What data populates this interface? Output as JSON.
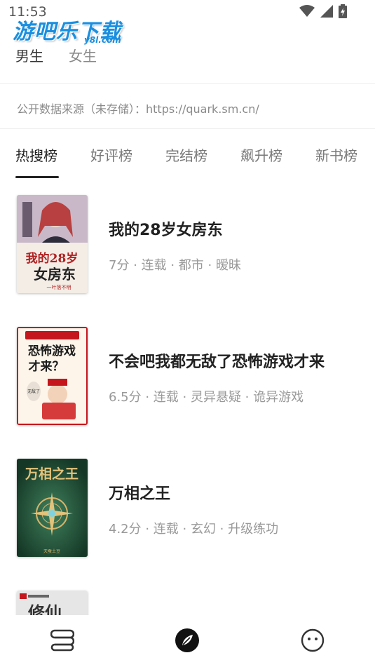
{
  "status_bar": {
    "time": "11:53"
  },
  "watermark": {
    "text": "游吧乐下载",
    "sub": "y8l.com"
  },
  "gender_tabs": [
    {
      "label": "男生",
      "active": true
    },
    {
      "label": "女生",
      "active": false
    }
  ],
  "source_note": "公开数据来源（未存储）：https://quark.sm.cn/",
  "rank_tabs": [
    {
      "label": "热搜榜",
      "active": true
    },
    {
      "label": "好评榜",
      "active": false
    },
    {
      "label": "完结榜",
      "active": false
    },
    {
      "label": "飙升榜",
      "active": false
    },
    {
      "label": "新书榜",
      "active": false
    }
  ],
  "books": [
    {
      "title": "我的28岁女房东",
      "meta": "7分 · 连载 · 都市 · 暧昧",
      "cover": {
        "text_lines": [
          "我的28岁",
          "女房东"
        ],
        "sub": "一叶落不明",
        "bg": "#e9e3de",
        "accent": "#b02020"
      }
    },
    {
      "title": "不会吧我都无敌了恐怖游戏才来",
      "meta": "6.5分 · 连载 · 灵异悬疑 · 诡异游戏",
      "cover": {
        "text_lines": [
          "恐怖游戏",
          "才来？"
        ],
        "sub": "无敌了",
        "bg": "#fdf4ea",
        "accent": "#c4161c"
      }
    },
    {
      "title": "万相之王",
      "meta": "4.2分 · 连载 · 玄幻 · 升级练功",
      "cover": {
        "text_lines": [
          "万相之王"
        ],
        "sub": "天蚕土豆",
        "bg": "#1f4e35",
        "accent": "#e3c27a"
      }
    },
    {
      "title": "",
      "meta": "",
      "cover": {
        "text_lines": [
          "修仙"
        ],
        "sub": "",
        "bg": "#e6e6e6",
        "accent": "#333333"
      }
    }
  ],
  "bottom_nav": [
    {
      "icon": "bookshelf-icon",
      "active": false
    },
    {
      "icon": "compass-icon",
      "active": true
    },
    {
      "icon": "smiley-icon",
      "active": false
    }
  ]
}
